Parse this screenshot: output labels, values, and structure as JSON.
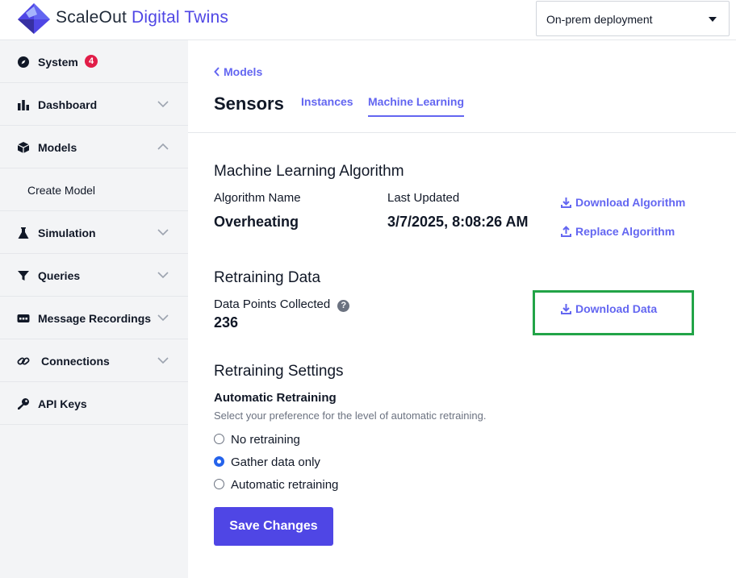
{
  "header": {
    "brand_part1": "ScaleOut",
    "brand_part2": " Digital Twins",
    "deployment_selected": "On-prem deployment"
  },
  "sidebar": {
    "system": {
      "label": "System",
      "badge": "4"
    },
    "dashboard": {
      "label": "Dashboard"
    },
    "models": {
      "label": "Models"
    },
    "create_model": {
      "label": "Create Model"
    },
    "simulation": {
      "label": "Simulation"
    },
    "queries": {
      "label": "Queries"
    },
    "message_recordings": {
      "label": "Message Recordings"
    },
    "connections": {
      "label": "Connections"
    },
    "api_keys": {
      "label": "API Keys"
    }
  },
  "main": {
    "back_label": "Models",
    "title": "Sensors",
    "tabs": [
      {
        "label": "Instances"
      },
      {
        "label": "Machine Learning"
      }
    ],
    "algorithm": {
      "section_title": "Machine Learning Algorithm",
      "name_label": "Algorithm Name",
      "name_value": "Overheating",
      "updated_label": "Last Updated",
      "updated_value": "3/7/2025, 8:08:26 AM",
      "download_label": "Download Algorithm",
      "replace_label": "Replace Algorithm"
    },
    "retraining_data": {
      "section_title": "Retraining Data",
      "points_label": "Data Points Collected",
      "help_glyph": "?",
      "points_value": "236",
      "download_label": "Download Data"
    },
    "retraining_settings": {
      "section_title": "Retraining Settings",
      "subtitle": "Automatic Retraining",
      "hint": "Select your preference for the level of automatic retraining.",
      "options": [
        {
          "label": "No retraining",
          "checked": false
        },
        {
          "label": "Gather data only",
          "checked": true
        },
        {
          "label": "Automatic retraining",
          "checked": false
        }
      ]
    },
    "save_label": "Save Changes"
  },
  "colors": {
    "accent": "#4f46e5",
    "link": "#6366f1",
    "badge": "#e11d48",
    "highlight": "#22a447",
    "sidebar_bg": "#f3f4f6"
  }
}
